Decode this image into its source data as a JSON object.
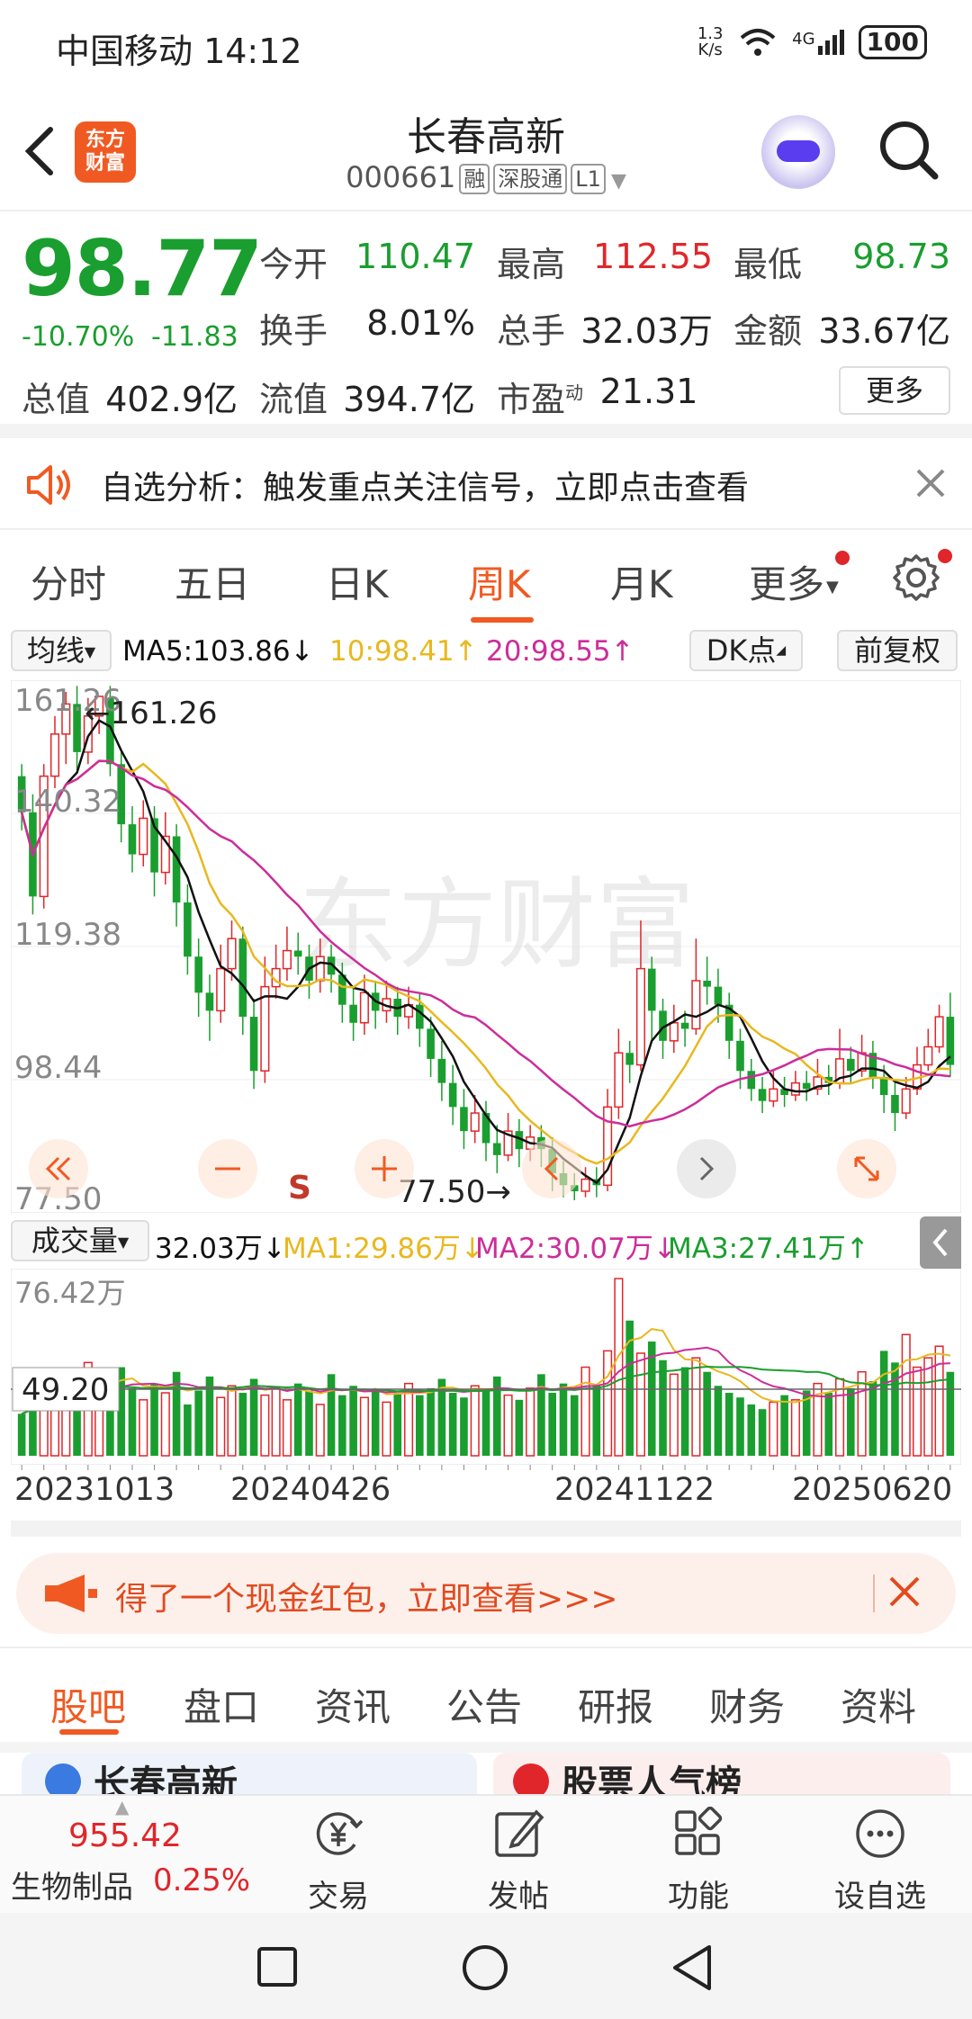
{
  "status_bar": {
    "carrier_time": "中国移动 14:12",
    "net_speed": "1.3 K/s",
    "signal": "4G",
    "battery": "100"
  },
  "header": {
    "back_icon": "chevron-left-icon",
    "logo_text": "东方财富",
    "stock_name": "长春高新",
    "stock_code": "000661",
    "tags": [
      "融",
      "深股通",
      "L1"
    ],
    "assistant_icon": "robot-avatar-icon",
    "search_icon": "search-icon"
  },
  "quote": {
    "price": "98.77",
    "change_pct": "-10.70%",
    "change_abs": "-11.83",
    "stats": [
      {
        "label": "今开",
        "value": "110.47",
        "color": "#1a9e2f"
      },
      {
        "label": "最高",
        "value": "112.55",
        "color": "#e0262a"
      },
      {
        "label": "最低",
        "value": "98.73",
        "color": "#1a9e2f"
      },
      {
        "label": "换手",
        "value": "8.01%",
        "color": "#222222"
      },
      {
        "label": "总手",
        "value": "32.03万",
        "color": "#222222"
      },
      {
        "label": "金额",
        "value": "33.67亿",
        "color": "#222222"
      },
      {
        "label": "总值",
        "value": "402.9亿",
        "color": "#222222"
      },
      {
        "label": "流值",
        "value": "394.7亿",
        "color": "#222222"
      },
      {
        "label": "市盈",
        "label_sup": "动",
        "value": "21.31",
        "color": "#222222"
      }
    ],
    "more_button": "更多"
  },
  "notice": {
    "icon": "speaker-icon",
    "text": "自选分析：触发重点关注信号，立即点击查看",
    "close_icon": "close-icon"
  },
  "chart_tabs": {
    "items": [
      "分时",
      "五日",
      "日K",
      "周K",
      "月K",
      "更多"
    ],
    "active_index": 3,
    "settings_icon": "gear-icon"
  },
  "ma_bar": {
    "selector": "均线",
    "ma5": "MA5:103.86↓",
    "ma10": "10:98.41↑",
    "ma20": "20:98.55↑",
    "dk_button": "DK点",
    "adjust_button": "前复权",
    "colors": {
      "ma5": "#111111",
      "ma10": "#e8b820",
      "ma20": "#cc2d9a"
    }
  },
  "kline": {
    "y_ticks": [
      "161.26",
      "140.32",
      "119.38",
      "98.44",
      "77.50"
    ],
    "max_label": "161.26",
    "min_label": "77.50",
    "watermark": "东方财富",
    "s_marker": "S"
  },
  "chart_controls": [
    "rewind-icon",
    "zoom-out-icon",
    "zoom-in-icon",
    "back-icon",
    "forward-icon",
    "expand-icon"
  ],
  "volume_bar": {
    "selector": "成交量",
    "vol": "32.03万↓",
    "ma1": "MA1:29.86万↓",
    "ma2": "MA2:30.07万↓",
    "ma3": "MA3:27.41万↑",
    "y_max": "76.42万",
    "cursor_value": "49.20",
    "colors": {
      "ma1": "#e8b820",
      "ma2": "#cc2d9a",
      "ma3": "#1a9e2f"
    }
  },
  "dates": [
    "20231013",
    "20240426",
    "20241122",
    "20250620"
  ],
  "promo": {
    "icon": "megaphone-icon",
    "text": "得了一个现金红包，立即查看>>>",
    "close_icon": "close-icon"
  },
  "sub_tabs": {
    "items": [
      "股吧",
      "盘口",
      "资讯",
      "公告",
      "研报",
      "财务",
      "资料"
    ],
    "active_index": 0
  },
  "peek_cards": [
    "长春高新",
    "股票人气榜"
  ],
  "bottom_bar": {
    "index_value": "955.42",
    "index_name": "生物制品",
    "index_pct": "0.25%",
    "items": [
      {
        "label": "交易",
        "icon": "yen-trade-icon"
      },
      {
        "label": "发帖",
        "icon": "edit-post-icon"
      },
      {
        "label": "功能",
        "icon": "grid-apps-icon"
      },
      {
        "label": "设自选",
        "icon": "more-dots-icon"
      }
    ]
  },
  "nav_bar": [
    "square-recents-icon",
    "circle-home-icon",
    "triangle-back-icon"
  ],
  "chart_data": {
    "type": "candlestick",
    "title": "",
    "ylim": [
      77.5,
      161.26
    ],
    "x_ticks": [
      "20231013",
      "20240426",
      "20241122",
      "20250620"
    ],
    "candles": [
      [
        148,
        142,
        150,
        139
      ],
      [
        142,
        128,
        145,
        125
      ],
      [
        128,
        148,
        150,
        126
      ],
      [
        148,
        155,
        158,
        146
      ],
      [
        155,
        160,
        162,
        150
      ],
      [
        160,
        152,
        163,
        149
      ],
      [
        152,
        158,
        161,
        150
      ],
      [
        158,
        161.26,
        161.26,
        155
      ],
      [
        161,
        150,
        163,
        148
      ],
      [
        150,
        140,
        152,
        137
      ],
      [
        140,
        135,
        143,
        132
      ],
      [
        135,
        141,
        144,
        133
      ],
      [
        141,
        132,
        143,
        128
      ],
      [
        132,
        138,
        142,
        130
      ],
      [
        138,
        127,
        140,
        123
      ],
      [
        127,
        118,
        130,
        115
      ],
      [
        118,
        112,
        121,
        108
      ],
      [
        112,
        109,
        115,
        104
      ],
      [
        109,
        116,
        120,
        107
      ],
      [
        116,
        121,
        124,
        114
      ],
      [
        121,
        108,
        123,
        105
      ],
      [
        108,
        99,
        111,
        96
      ],
      [
        99,
        113,
        118,
        97
      ],
      [
        113,
        116,
        120,
        111
      ],
      [
        116,
        119,
        123,
        114
      ],
      [
        119,
        118,
        122,
        115
      ],
      [
        118,
        114,
        120,
        111
      ],
      [
        114,
        118,
        121,
        112
      ],
      [
        118,
        115,
        120,
        112
      ],
      [
        115,
        110,
        117,
        107
      ],
      [
        110,
        107,
        113,
        104
      ],
      [
        107,
        112,
        115,
        105
      ],
      [
        112,
        109,
        114,
        106
      ],
      [
        109,
        111,
        114,
        107
      ],
      [
        111,
        108,
        113,
        105
      ],
      [
        108,
        110,
        113,
        106
      ],
      [
        110,
        106,
        112,
        103
      ],
      [
        106,
        101,
        108,
        98
      ],
      [
        101,
        97,
        104,
        94
      ],
      [
        97,
        93,
        100,
        90
      ],
      [
        93,
        89,
        96,
        86
      ],
      [
        89,
        92,
        95,
        87
      ],
      [
        92,
        87,
        94,
        84
      ],
      [
        87,
        85,
        90,
        82
      ],
      [
        85,
        89,
        92,
        84
      ],
      [
        89,
        86,
        91,
        83
      ],
      [
        86,
        88,
        90,
        84
      ],
      [
        88,
        86,
        90,
        83
      ],
      [
        86,
        82,
        88,
        79
      ],
      [
        82,
        80,
        84,
        78
      ],
      [
        80,
        79,
        82,
        77.5
      ],
      [
        79,
        81,
        83,
        78
      ],
      [
        81,
        80,
        83,
        78
      ],
      [
        80,
        93,
        96,
        79
      ],
      [
        93,
        102,
        106,
        91
      ],
      [
        102,
        100,
        104,
        97
      ],
      [
        100,
        116,
        124,
        99
      ],
      [
        116,
        109,
        118,
        104
      ],
      [
        109,
        104,
        111,
        101
      ],
      [
        104,
        107,
        110,
        102
      ],
      [
        107,
        106,
        109,
        103
      ],
      [
        106,
        114,
        121,
        105
      ],
      [
        114,
        113,
        118,
        110
      ],
      [
        113,
        110,
        116,
        107
      ],
      [
        110,
        104,
        112,
        101
      ],
      [
        104,
        99,
        106,
        96
      ],
      [
        99,
        96,
        101,
        94
      ],
      [
        96,
        94,
        98,
        92
      ],
      [
        94,
        96,
        99,
        93
      ],
      [
        96,
        95,
        98,
        93
      ],
      [
        95,
        97,
        99,
        94
      ],
      [
        97,
        96,
        99,
        94
      ],
      [
        96,
        98,
        101,
        95
      ],
      [
        98,
        97,
        100,
        95
      ],
      [
        97,
        101,
        106,
        96
      ],
      [
        101,
        99,
        103,
        97
      ],
      [
        99,
        102,
        105,
        98
      ],
      [
        102,
        98,
        104,
        96
      ],
      [
        98,
        95,
        100,
        92
      ],
      [
        95,
        92,
        97,
        89
      ],
      [
        92,
        96,
        98,
        91
      ],
      [
        96,
        100,
        103,
        95
      ],
      [
        100,
        103,
        106,
        99
      ],
      [
        103,
        108,
        110,
        102
      ],
      [
        108,
        100,
        112,
        98
      ]
    ],
    "ma_series": [
      {
        "name": "MA5",
        "color": "#111111"
      },
      {
        "name": "10",
        "color": "#e8b820"
      },
      {
        "name": "20",
        "color": "#cc2d9a"
      }
    ],
    "volume_ylim": [
      0,
      76.42
    ],
    "volumes": [
      18,
      22,
      30,
      35,
      28,
      25,
      40,
      33,
      26,
      38,
      29,
      24,
      31,
      27,
      36,
      22,
      28,
      34,
      25,
      30,
      27,
      33,
      26,
      29,
      24,
      31,
      28,
      22,
      35,
      26,
      30,
      25,
      28,
      23,
      27,
      31,
      26,
      29,
      33,
      27,
      25,
      30,
      28,
      34,
      26,
      24,
      29,
      35,
      27,
      31,
      26,
      38,
      30,
      45,
      76,
      58,
      44,
      49,
      41,
      35,
      38,
      42,
      36,
      30,
      27,
      25,
      22,
      20,
      23,
      26,
      24,
      28,
      31,
      27,
      33,
      29,
      36,
      32,
      45,
      40,
      52,
      38,
      42,
      47,
      36
    ]
  }
}
